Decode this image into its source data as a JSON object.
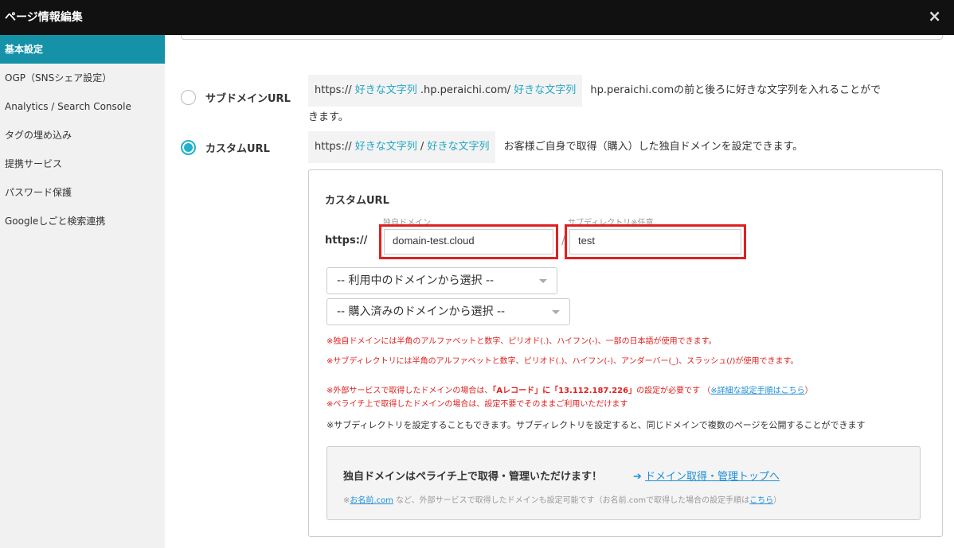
{
  "window": {
    "title": "ページ情報編集",
    "close_glyph": "×"
  },
  "sidebar": {
    "items": [
      {
        "label": "基本設定",
        "active": true
      },
      {
        "label": "OGP（SNSシェア設定）"
      },
      {
        "label": "Analytics / Search Console"
      },
      {
        "label": "タグの埋め込み"
      },
      {
        "label": "提携サービス"
      },
      {
        "label": "パスワード保護"
      },
      {
        "label": "Googleしごと検索連携"
      }
    ]
  },
  "url_options": {
    "subdomain": {
      "label": "サブドメインURL",
      "selected": false,
      "prefix": "https://",
      "hl1": "好きな文字列",
      "middle": ".hp.peraichi.com/",
      "hl2": "好きな文字列",
      "desc1": "hp.peraichi.comの前と後ろに好きな文字列を入れることがで",
      "desc2": "きます。"
    },
    "custom": {
      "label": "カスタムURL",
      "selected": true,
      "prefix": "https://",
      "hl1": "好きな文字列",
      "sep": "/",
      "hl2": "好きな文字列",
      "desc": "お客様ご自身で取得（購入）した独自ドメインを設定できます。"
    }
  },
  "custom_panel": {
    "title": "カスタムURL",
    "https_label": "https://",
    "domain_label": "独自ドメイン",
    "domain_value": "domain-test.cloud",
    "slash": "/",
    "subdir_label": "サブディレクトリ※任意",
    "subdir_value": "test",
    "select_in_use": "-- 利用中のドメインから選択 --",
    "select_purchased": "-- 購入済みのドメインから選択 --",
    "note_domain": "※独自ドメインには半角のアルファベットと数字、ピリオド(.)、ハイフン(-)、一部の日本語が使用できます。",
    "note_subdir": "※サブディレクトリには半角のアルファベットと数字、ピリオド(.)、ハイフン(-)、アンダーバー(_)、スラッシュ(/)が使用できます。",
    "note_external_a": "※外部サービスで取得したドメインの場合は、",
    "note_external_b": "「Aレコード」に「13.112.187.226」",
    "note_external_c": "の設定が必要です （",
    "note_external_link": "※詳細な設定手順はこちら",
    "note_external_d": "）",
    "note_peraichi": "※ペライチ上で取得したドメインの場合は、設定不要でそのままご利用いただけます",
    "note_multi": "※サブディレクトリを設定することもできます。サブディレクトリを設定すると、同じドメインで複数のページを公開することができます",
    "info": {
      "head": "独自ドメインはペライチ上で取得・管理いただけます！",
      "link_arrow": "➔",
      "link_text": "ドメイン取得・管理トップへ",
      "sub_a": "※",
      "sub_link1": "お名前.com",
      "sub_b": " など、外部サービスで取得したドメインも設定可能です（お名前.comで取得した場合の設定手順は",
      "sub_link2": "こちら",
      "sub_c": "）"
    }
  },
  "colors": {
    "accent": "#22b0cc",
    "sidebar_active": "#1592a8",
    "alert": "#e02020",
    "link": "#1f8fd6"
  }
}
